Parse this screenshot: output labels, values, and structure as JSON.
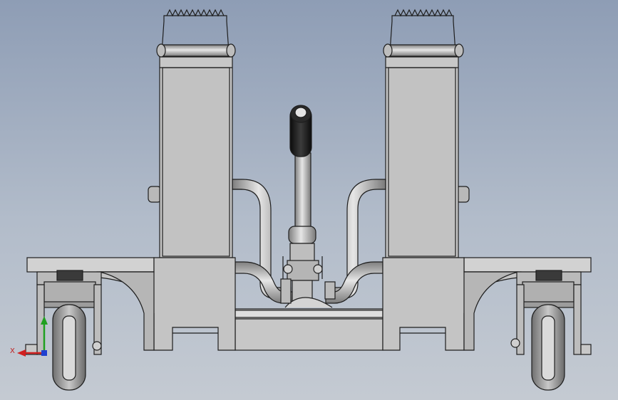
{
  "viewport": {
    "background_top": "#8e9db5",
    "background_bottom": "#c4cad2"
  },
  "model": {
    "part_fill": "#c7c7c7",
    "part_shade": "#a9a9a9",
    "edge_color": "#1e1e1e",
    "wheel_tire": "#8c8c8c",
    "handle_grip": "#1a1a1a",
    "pipe_light": "#e2e2e2",
    "pipe_dark": "#7e7e7e"
  },
  "triad": {
    "x_label": "X",
    "x_color": "#d02020",
    "y_color": "#20a020",
    "z_color": "#2040d0",
    "icon": "coordinate-triad-icon"
  }
}
